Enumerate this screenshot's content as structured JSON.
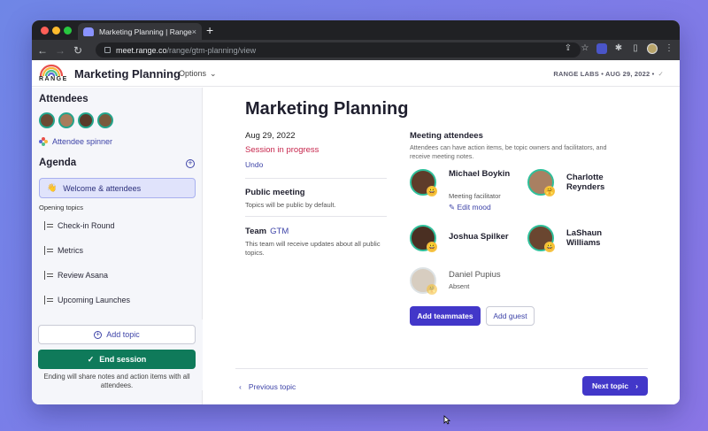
{
  "browser": {
    "tab_title": "Marketing Planning | Range",
    "tab_close": "×",
    "new_tab": "+",
    "url_host": "meet.range.co",
    "url_path": "/range/gtm-planning/view"
  },
  "header": {
    "logo_text": "RANGE",
    "title": "Marketing Planning",
    "options_label": "Options",
    "org_date": "RANGE LABS • AUG 29, 2022 •"
  },
  "sidebar": {
    "attendees_heading": "Attendees",
    "attendee_spinner": "Attendee spinner",
    "agenda_heading": "Agenda",
    "welcome_item": "Welcome & attendees",
    "section_label": "Opening topics",
    "topics": [
      {
        "label": "Check-in Round"
      },
      {
        "label": "Metrics"
      },
      {
        "label": "Review Asana"
      },
      {
        "label": "Upcoming Launches"
      }
    ],
    "add_topic": "Add topic",
    "end_session": "End session",
    "ending_note": "Ending will share notes and action items with all attendees."
  },
  "main": {
    "title": "Marketing Planning",
    "date": "Aug 29, 2022",
    "status": "Session in progress",
    "undo": "Undo",
    "public_heading": "Public meeting",
    "public_desc": "Topics will be public by default.",
    "team_heading": "Team",
    "team_name": "GTM",
    "team_desc": "This team will receive updates about all public topics.",
    "attendees_heading": "Meeting attendees",
    "attendees_desc": "Attendees can have action items, be topic owners and facilitators, and receive meeting notes.",
    "people": [
      {
        "name": "Michael Boykin",
        "role": "Meeting facilitator",
        "emoji": "😀"
      },
      {
        "name": "Charlotte Reynders",
        "role": "",
        "emoji": "🤗"
      },
      {
        "name": "Joshua Spilker",
        "role": "",
        "emoji": "😀"
      },
      {
        "name": "LaShaun Williams",
        "role": "",
        "emoji": "😀"
      },
      {
        "name": "Daniel Pupius",
        "role": "Absent",
        "emoji": "🤗"
      }
    ],
    "edit_mood": "Edit mood",
    "add_teammates": "Add teammates",
    "add_guest": "Add guest",
    "prev_topic": "Previous topic",
    "next_topic": "Next topic"
  },
  "colors": {
    "accent": "#4237c9",
    "status_red": "#c7274d",
    "end_green": "#0f7a5a",
    "presence_ring": "#2fbf9a"
  }
}
